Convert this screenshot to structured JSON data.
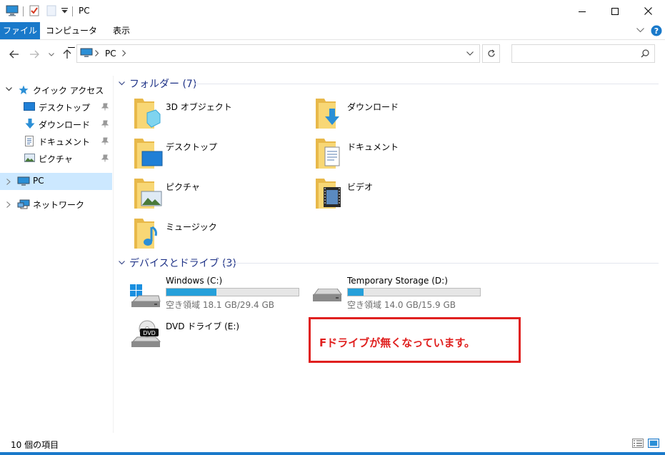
{
  "window": {
    "title": "PC"
  },
  "ribbon": {
    "tabs": [
      {
        "label": "ファイル"
      },
      {
        "label": "コンピューター"
      },
      {
        "label": "表示"
      }
    ]
  },
  "address": {
    "path": [
      "PC"
    ]
  },
  "search": {
    "placeholder": ""
  },
  "nav": {
    "quick_access": "クイック アクセス",
    "quick_items": [
      {
        "label": "デスクトップ"
      },
      {
        "label": "ダウンロード"
      },
      {
        "label": "ドキュメント"
      },
      {
        "label": "ピクチャ"
      }
    ],
    "pc": "PC",
    "network": "ネットワーク"
  },
  "folders": {
    "header": "フォルダー (7)",
    "items": [
      {
        "label": "3D オブジェクト"
      },
      {
        "label": "ダウンロード"
      },
      {
        "label": "デスクトップ"
      },
      {
        "label": "ドキュメント"
      },
      {
        "label": "ピクチャ"
      },
      {
        "label": "ビデオ"
      },
      {
        "label": "ミュージック"
      }
    ]
  },
  "drives": {
    "header": "デバイスとドライブ (3)",
    "items": [
      {
        "name": "Windows (C:)",
        "free": "空き領域 18.1 GB/29.4 GB",
        "used_fraction": 0.38
      },
      {
        "name": "Temporary Storage (D:)",
        "free": "空き領域 14.0 GB/15.9 GB",
        "used_fraction": 0.12
      },
      {
        "name": "DVD ドライブ (E:)"
      }
    ]
  },
  "annotation": {
    "text": "Fドライブが無くなっています。",
    "color": "#e0201f"
  },
  "status": {
    "count": "10 個の項目"
  },
  "colors": {
    "accent": "#1979ca",
    "header_text": "#1e3287",
    "folder": "#f8d775",
    "bar_fill": "#26a0da"
  },
  "icons": [
    "pc-icon",
    "properties-icon",
    "new-folder-icon",
    "dropdown-icon",
    "minimize-icon",
    "maximize-icon",
    "close-icon",
    "help-icon",
    "back-arrow-icon",
    "forward-arrow-icon",
    "up-arrow-icon",
    "refresh-icon",
    "search-icon",
    "star-icon",
    "pin-icon",
    "network-icon",
    "folder-icon",
    "drive-icon",
    "dvd-icon"
  ]
}
